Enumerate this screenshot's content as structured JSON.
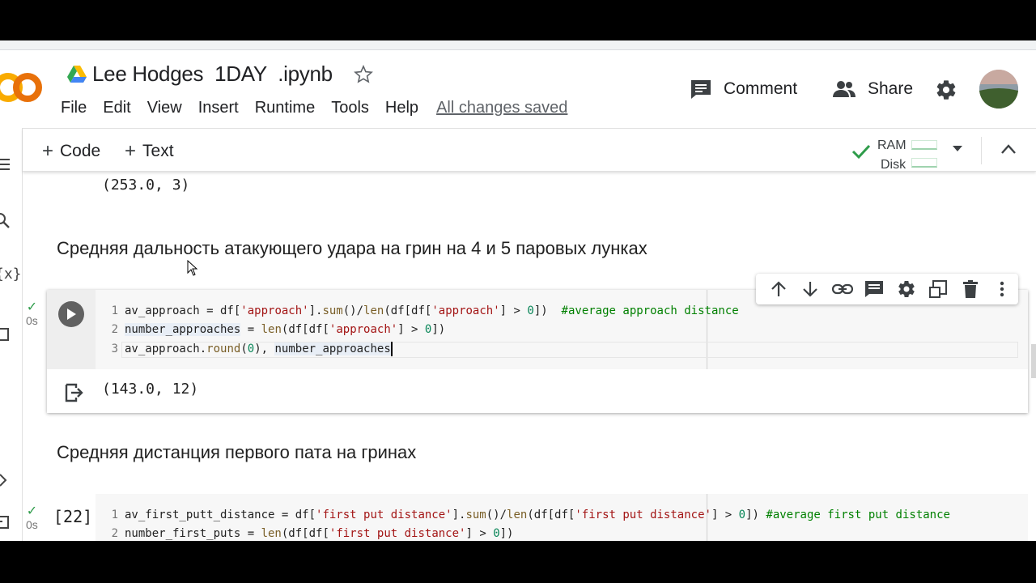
{
  "app": {
    "notebook_title": "Lee Hodges  1DAY  .ipynb",
    "logo_text": "CO",
    "save_status": "All changes saved"
  },
  "menu": [
    "File",
    "Edit",
    "View",
    "Insert",
    "Runtime",
    "Tools",
    "Help"
  ],
  "header": {
    "comment_label": "Comment",
    "share_label": "Share"
  },
  "toolbar": {
    "add_code_label": "Code",
    "add_text_label": "Text",
    "ram_label": "RAM",
    "disk_label": "Disk"
  },
  "notebook": {
    "prev_output": "(253.0, 3)",
    "heading_1": "Средняя дальность атакующего удара на грин на 4 и 5 паровых лунках",
    "cell_1": {
      "exec_status": "0s",
      "line_numbers": [
        "1",
        "2",
        "3"
      ],
      "output": "(143.0, 12)"
    },
    "heading_2": "Средняя дистанция первого пата на гринах",
    "cell_2": {
      "exec_count": "[22]",
      "exec_status": "0s",
      "line_numbers": [
        "1",
        "2"
      ]
    }
  },
  "colors": {
    "accent_orange": "#f9ab00",
    "success_green": "#2e9c4a",
    "string_red": "#a31515",
    "comment_green": "#008000",
    "number_green": "#098658"
  },
  "icons": [
    "drive-icon",
    "star-icon",
    "comment-icon",
    "share-icon",
    "settings-icon",
    "check-icon",
    "dropdown-icon",
    "collapse-icon",
    "run-icon",
    "output-icon",
    "move-up-icon",
    "move-down-icon",
    "link-icon",
    "comment-cell-icon",
    "cell-settings-icon",
    "mirror-cell-icon",
    "delete-icon",
    "more-icon"
  ]
}
